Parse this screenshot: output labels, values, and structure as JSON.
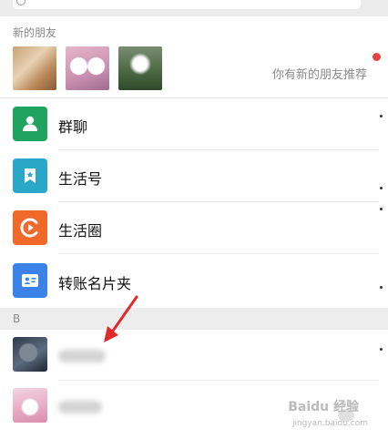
{
  "new_friends": {
    "title": "新的朋友",
    "hint": "你有新的朋友推荐"
  },
  "rows": [
    {
      "label": "群聊",
      "color": "#1fa35f",
      "icon": "group-chat-icon"
    },
    {
      "label": "生活号",
      "color": "#2aa6c8",
      "icon": "life-account-icon"
    },
    {
      "label": "生活圈",
      "color": "#f0682a",
      "icon": "life-circle-icon"
    },
    {
      "label": "转账名片夹",
      "color": "#3b82e6",
      "icon": "card-folder-icon"
    }
  ],
  "section": {
    "label": "B"
  },
  "contacts": [
    {
      "name": ""
    },
    {
      "name": ""
    }
  ],
  "watermark": {
    "text": "Baidu 经验",
    "url": "jingyan.baidu.com"
  },
  "colors": {
    "accent_red": "#e64340",
    "arrow_red": "#e02a2a"
  }
}
